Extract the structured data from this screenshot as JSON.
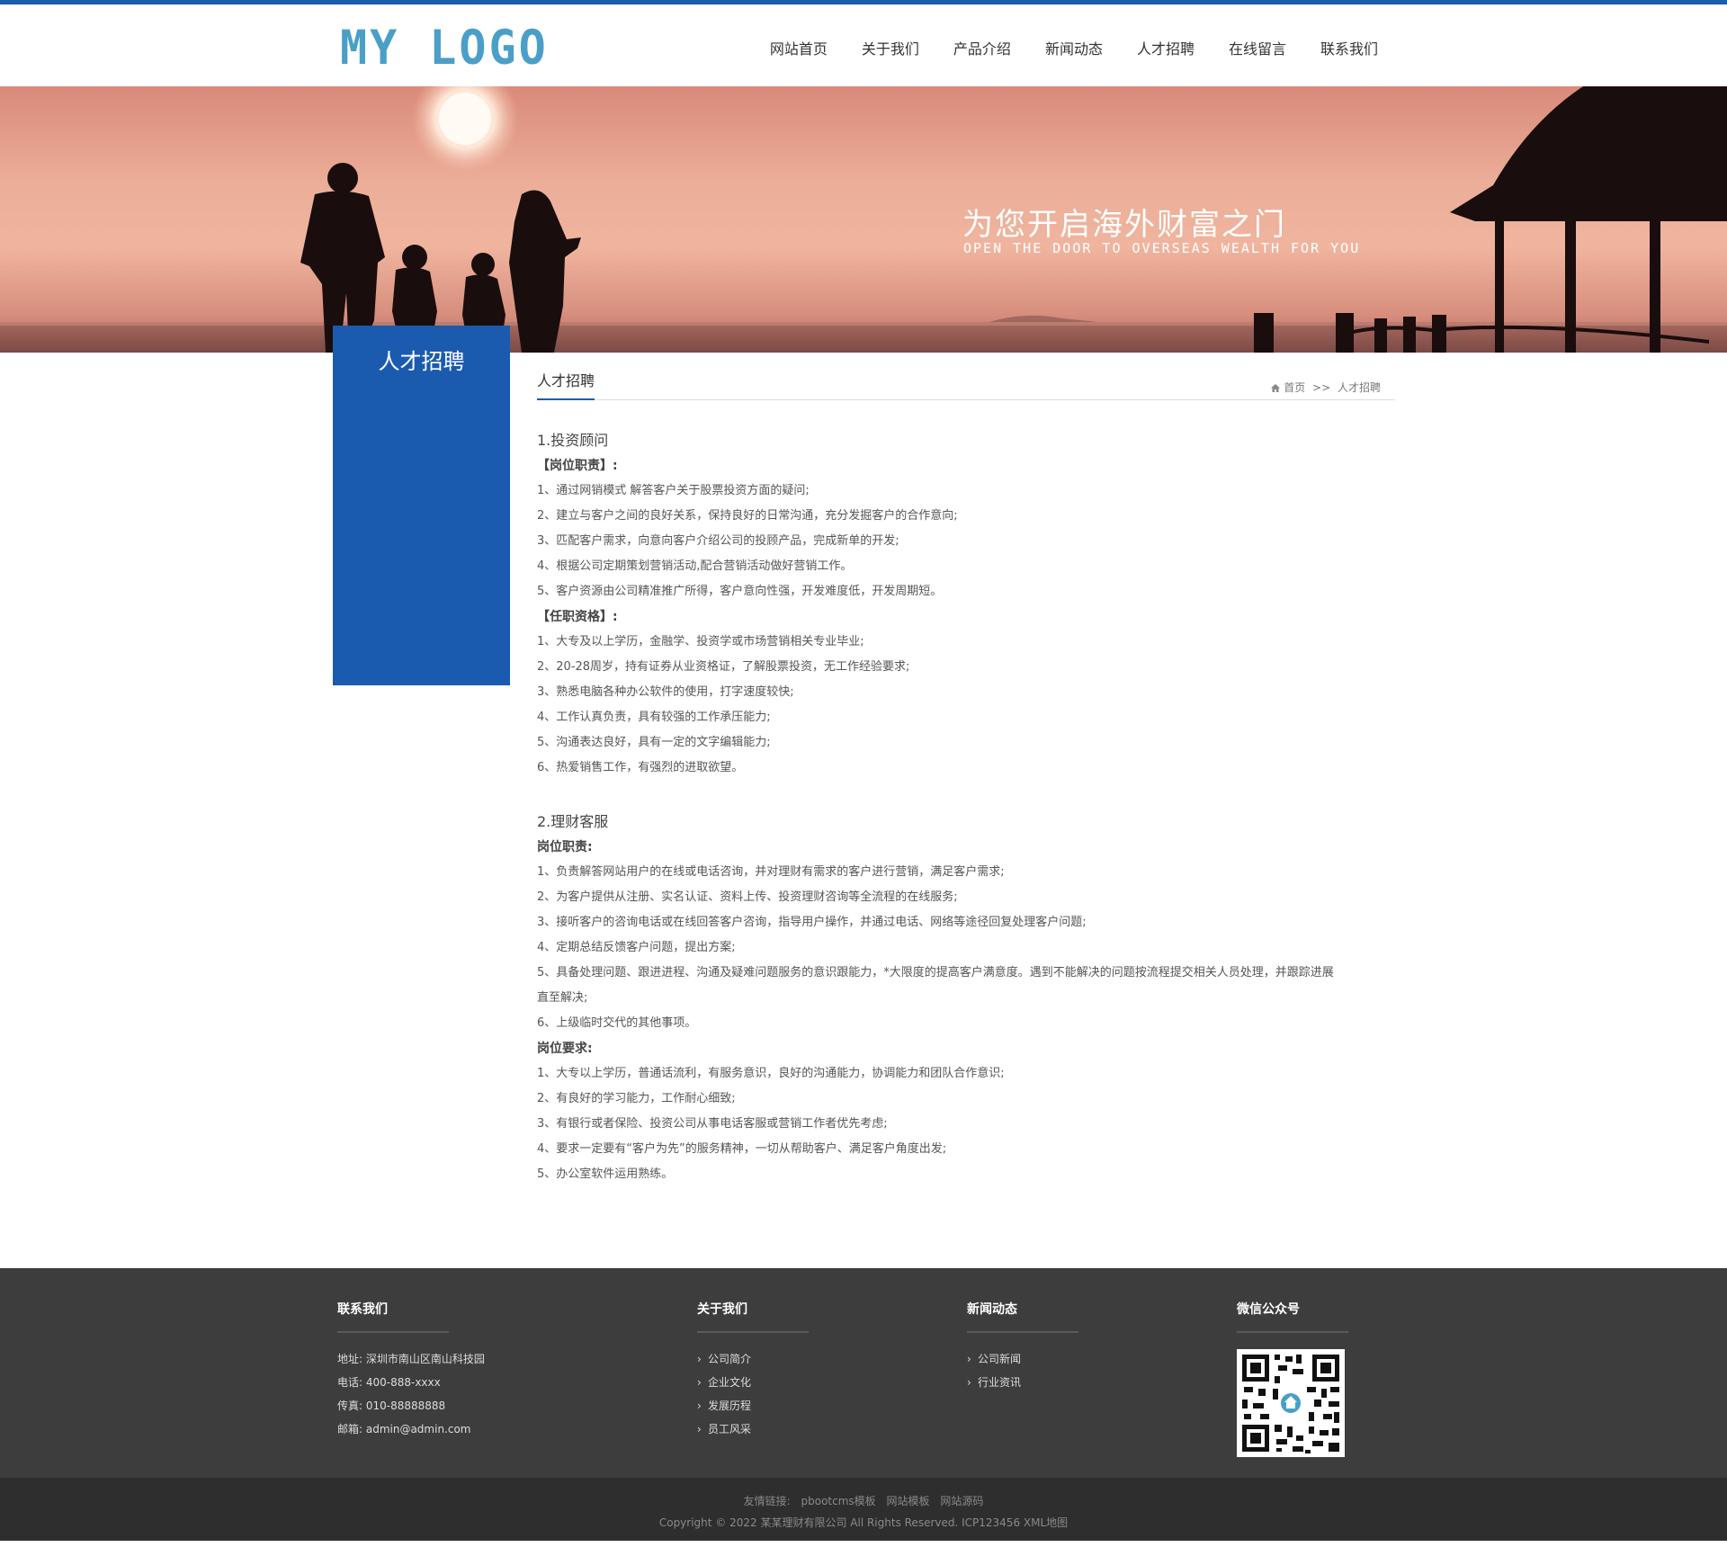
{
  "brand": {
    "logo_text": "MY LOGO",
    "accent": "#1b5cad",
    "logo_color": "#4a9fc8"
  },
  "nav": {
    "items": [
      {
        "label": "网站首页"
      },
      {
        "label": "关于我们"
      },
      {
        "label": "产品介绍"
      },
      {
        "label": "新闻动态"
      },
      {
        "label": "人才招聘"
      },
      {
        "label": "在线留言"
      },
      {
        "label": "联系我们"
      }
    ]
  },
  "banner": {
    "title": "为您开启海外财富之门",
    "subtitle": "OPEN THE DOOR TO OVERSEAS WEALTH FOR YOU"
  },
  "sidebar": {
    "title": "人才招聘"
  },
  "page": {
    "heading": "人才招聘",
    "breadcrumb": {
      "home": "首页",
      "separator": ">>",
      "current": "人才招聘"
    }
  },
  "jobs": [
    {
      "title": "1.投资顾问",
      "sections": [
        {
          "heading": "【岗位职责】:",
          "lines": [
            "1、通过网销模式 解答客户关于股票投资方面的疑问;",
            "2、建立与客户之间的良好关系，保持良好的日常沟通，充分发掘客户的合作意向;",
            "3、匹配客户需求，向意向客户介绍公司的投顾产品，完成新单的开发;",
            "4、根据公司定期策划营销活动,配合营销活动做好营销工作。",
            "5、客户资源由公司精准推广所得，客户意向性强，开发难度低，开发周期短。"
          ]
        },
        {
          "heading": "【任职资格】:",
          "lines": [
            "1、大专及以上学历，金融学、投资学或市场营销相关专业毕业;",
            "2、20-28周岁，持有证券从业资格证，了解股票投资，无工作经验要求;",
            "3、熟悉电脑各种办公软件的使用，打字速度较快;",
            "4、工作认真负责，具有较强的工作承压能力;",
            "5、沟通表达良好，具有一定的文字编辑能力;",
            "6、热爱销售工作，有强烈的进取欲望。"
          ]
        }
      ]
    },
    {
      "title": "2.理财客服",
      "sections": [
        {
          "heading": "岗位职责:",
          "lines": [
            "1、负责解答网站用户的在线或电话咨询，并对理财有需求的客户进行营销，满足客户需求;",
            "2、为客户提供从注册、实名认证、资料上传、投资理财咨询等全流程的在线服务;",
            "3、接听客户的咨询电话或在线回答客户咨询，指导用户操作，并通过电话、网络等途径回复处理客户问题;",
            "4、定期总结反馈客户问题，提出方案;",
            "5、具备处理问题、跟进进程、沟通及疑难问题服务的意识跟能力，*大限度的提高客户满意度。遇到不能解决的问题按流程提交相关人员处理，并跟踪进展",
            "直至解决;",
            "6、上级临时交代的其他事项。"
          ]
        },
        {
          "heading": "岗位要求:",
          "lines": [
            "1、大专以上学历，普通话流利，有服务意识，良好的沟通能力，协调能力和团队合作意识;",
            "2、有良好的学习能力，工作耐心细致;",
            "3、有银行或者保险、投资公司从事电话客服或营销工作者优先考虑;",
            "4、要求一定要有“客户为先”的服务精神，一切从帮助客户、满足客户角度出发;",
            "5、办公室软件运用熟练。"
          ]
        }
      ]
    }
  ],
  "footer": {
    "contact": {
      "heading": "联系我们",
      "lines": [
        "地址: 深圳市南山区南山科技园",
        "电话: 400-888-xxxx",
        "传真: 010-88888888",
        "邮箱: admin@admin.com"
      ]
    },
    "about": {
      "heading": "关于我们",
      "links": [
        "公司简介",
        "企业文化",
        "发展历程",
        "员工风采"
      ]
    },
    "news": {
      "heading": "新闻动态",
      "links": [
        "公司新闻",
        "行业资讯"
      ]
    },
    "wechat": {
      "heading": "微信公众号"
    },
    "friend_links": {
      "label": "友情链接:",
      "links": [
        "pbootcms模板",
        "网站模板",
        "网站源码"
      ]
    },
    "copyright": "Copyright © 2022 某某理财有限公司 All Rights Reserved. ICP123456 XML地图"
  }
}
